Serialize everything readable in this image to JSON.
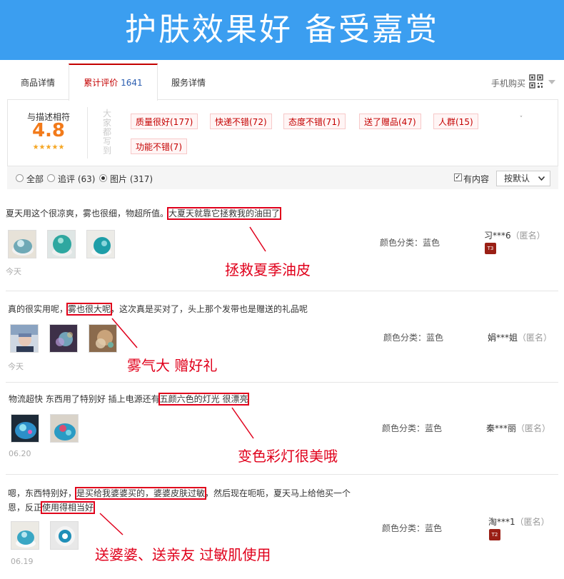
{
  "banner": {
    "title": "护肤效果好  备受嘉赏"
  },
  "tabs": [
    {
      "label": "商品详情"
    },
    {
      "label": "累计评价",
      "count": "1641"
    },
    {
      "label": "服务详情"
    }
  ],
  "mobile_buy": {
    "label": "手机购买"
  },
  "rating": {
    "label": "与描述相符",
    "score": "4.8",
    "stars": "★★★★★",
    "stars_value": 4.8
  },
  "tags_header": "大家都写到",
  "tags": [
    {
      "label": "质量很好(177)"
    },
    {
      "label": "快递不错(72)"
    },
    {
      "label": "态度不错(71)"
    },
    {
      "label": "送了赠品(47)"
    },
    {
      "label": "人群(15)"
    },
    {
      "label": "功能不错(7)"
    }
  ],
  "filters": {
    "all": "全部",
    "followup": "追评 (63)",
    "images": "图片 (317)",
    "has_content": "有内容",
    "sort": "按默认"
  },
  "reviews": [
    {
      "text_before": "夏天用这个很凉爽，雾也很细，物超所值。",
      "highlight": "大夏天就靠它拯救我的油田了",
      "text_after": "",
      "line2_before": "",
      "line2_highlight": "",
      "date": "今天",
      "color_label": "颜色分类：蓝色",
      "user": "习***6",
      "anon": "（匿名）",
      "badge": "T3",
      "callout": "拯救夏季油皮"
    },
    {
      "text_before": "真的很实用呢，",
      "highlight": "雾也很大呢",
      "text_after": "，这次真是买对了，头上那个发带也是赠送的礼品呢",
      "date": "今天",
      "color_label": "颜色分类：蓝色",
      "user": "娟***姐",
      "anon": "（匿名）",
      "callout": "雾气大  赠好礼"
    },
    {
      "text_before": "物流超快 东西用了特别好 插上电源还有",
      "highlight": "五颜六色的灯光 很漂亮",
      "text_after": "",
      "date": "06.20",
      "color_label": "颜色分类：蓝色",
      "user": "秦***丽",
      "anon": "（匿名）",
      "callout": "变色彩灯很美哦"
    },
    {
      "text_before": "嗯，东西特别好，",
      "highlight": "是买给我婆婆买的，婆婆皮肤过敏",
      "text_after": "，然后现在呃呃，夏天马上给他买一个",
      "line2_before": "恩，反正",
      "line2_highlight": "使用得相当好",
      "date": "06.19",
      "color_label": "颜色分类：蓝色",
      "user": "淘***1",
      "anon": "（匿名）",
      "badge": "T2",
      "callout": "送婆婆、送亲友  过敏肌使用"
    }
  ],
  "colors": {
    "banner": "#3b9ef0",
    "accent": "#e0001b",
    "score": "#f27a1a"
  }
}
